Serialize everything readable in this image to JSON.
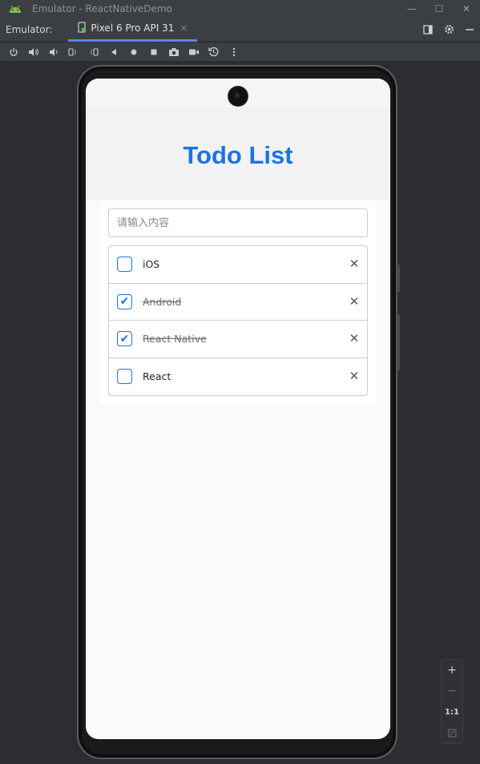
{
  "window": {
    "title": "Emulator - ReactNativeDemo",
    "controls": {
      "minimize": "—",
      "maximize": "☐",
      "close": "✕"
    }
  },
  "tabbar": {
    "label": "Emulator:",
    "device_tab": "Pixel 6 Pro API 31",
    "tab_close": "×"
  },
  "toolbar": {
    "icons": [
      "power-icon",
      "volume-up-icon",
      "volume-down-icon",
      "rotate-left-icon",
      "rotate-right-icon",
      "back-icon",
      "home-icon",
      "overview-icon",
      "screenshot-icon",
      "screen-record-icon",
      "snapshot-icon",
      "more-icon"
    ]
  },
  "app": {
    "title": "Todo List",
    "input_placeholder": "请输入内容",
    "todos": [
      {
        "label": "iOS",
        "done": false
      },
      {
        "label": "Android",
        "done": true
      },
      {
        "label": "React Native",
        "done": true
      },
      {
        "label": "React",
        "done": false
      }
    ],
    "check_glyph": "✔",
    "delete_glyph": "✕"
  },
  "zoom": {
    "in": "+",
    "out": "−",
    "actual": "1:1"
  },
  "colors": {
    "accent": "#1a73e8",
    "chrome": "#3c3f41",
    "tab_underline": "#5d8ae0"
  }
}
